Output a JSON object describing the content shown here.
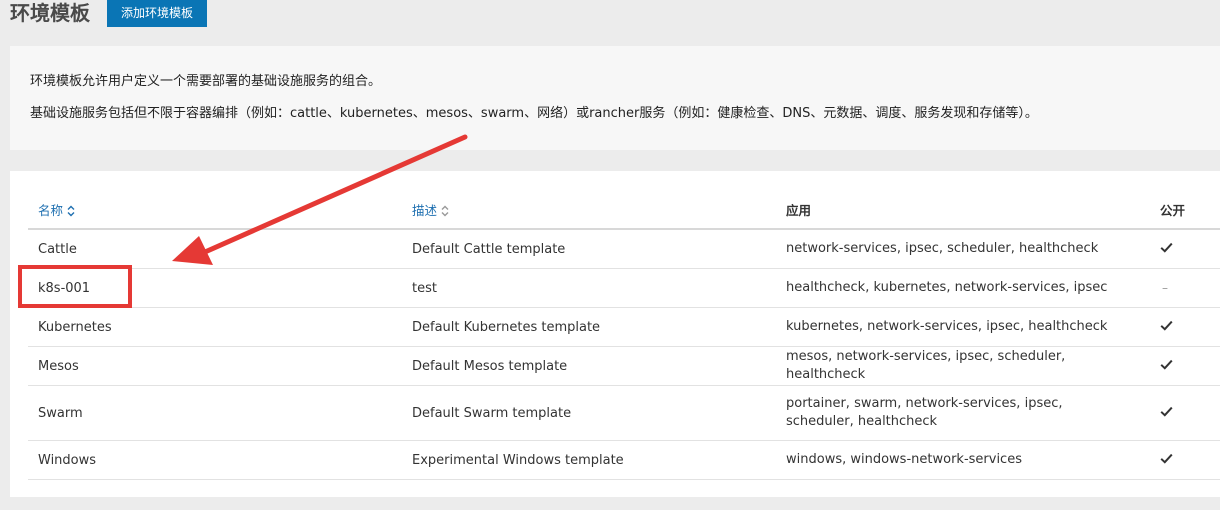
{
  "header": {
    "title": "环境模板",
    "add_button_label": "添加环境模板"
  },
  "description": {
    "line1": "环境模板允许用户定义一个需要部署的基础设施服务的组合。",
    "line2": "基础设施服务包括但不限于容器编排（例如：cattle、kubernetes、mesos、swarm、网络）或rancher服务（例如：健康检查、DNS、元数据、调度、服务发现和存储等）。"
  },
  "table": {
    "columns": {
      "name": "名称",
      "description": "描述",
      "apps": "应用",
      "public": "公开"
    },
    "rows": [
      {
        "name": "Cattle",
        "description": "Default Cattle template",
        "apps": "network-services, ipsec, scheduler, healthcheck",
        "public": true
      },
      {
        "name": "k8s-001",
        "description": "test",
        "apps": "healthcheck, kubernetes, network-services, ipsec",
        "public": false
      },
      {
        "name": "Kubernetes",
        "description": "Default Kubernetes template",
        "apps": "kubernetes, network-services, ipsec, healthcheck",
        "public": true
      },
      {
        "name": "Mesos",
        "description": "Default Mesos template",
        "apps": "mesos, network-services, ipsec, scheduler, healthcheck",
        "public": true
      },
      {
        "name": "Swarm",
        "description": "Default Swarm template",
        "apps": "portainer, swarm, network-services, ipsec, scheduler, healthcheck",
        "public": true
      },
      {
        "name": "Windows",
        "description": "Experimental Windows template",
        "apps": "windows, windows-network-services",
        "public": true
      }
    ],
    "not_public_mark": "–"
  },
  "annotation": {
    "highlight_color": "#e53935",
    "highlighted_row": "k8s-001"
  }
}
